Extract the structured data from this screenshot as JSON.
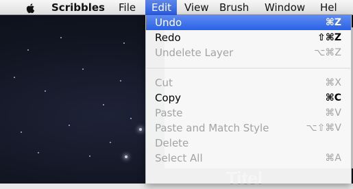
{
  "menubar": {
    "app_name": "Scribbles",
    "items": [
      "File",
      "Edit",
      "View",
      "Brush",
      "Window",
      "Hel"
    ],
    "active_item": "Edit"
  },
  "edit_menu": {
    "items": [
      {
        "label": "Undo",
        "shortcut": "⌘Z",
        "state": "highlighted"
      },
      {
        "label": "Redo",
        "shortcut": "⇧⌘Z",
        "state": "enabled"
      },
      {
        "label": "Undelete Layer",
        "shortcut": "⌥⌘Z",
        "state": "disabled"
      },
      {
        "label": "Cut",
        "shortcut": "⌘X",
        "state": "disabled"
      },
      {
        "label": "Copy",
        "shortcut": "⌘C",
        "state": "enabled"
      },
      {
        "label": "Paste",
        "shortcut": "⌘V",
        "state": "disabled"
      },
      {
        "label": "Paste and Match Style",
        "shortcut": "⌥⇧⌘V",
        "state": "disabled"
      },
      {
        "label": "Delete",
        "shortcut": "",
        "state": "disabled"
      },
      {
        "label": "Select All",
        "shortcut": "⌘A",
        "state": "disabled"
      }
    ]
  },
  "background_window": {
    "title_text": "Titel"
  },
  "colors": {
    "highlight": "#2a62e6",
    "disabled_text": "#a3a3a3",
    "desktop": "#111521"
  },
  "icons": {
    "apple": "apple-icon"
  }
}
